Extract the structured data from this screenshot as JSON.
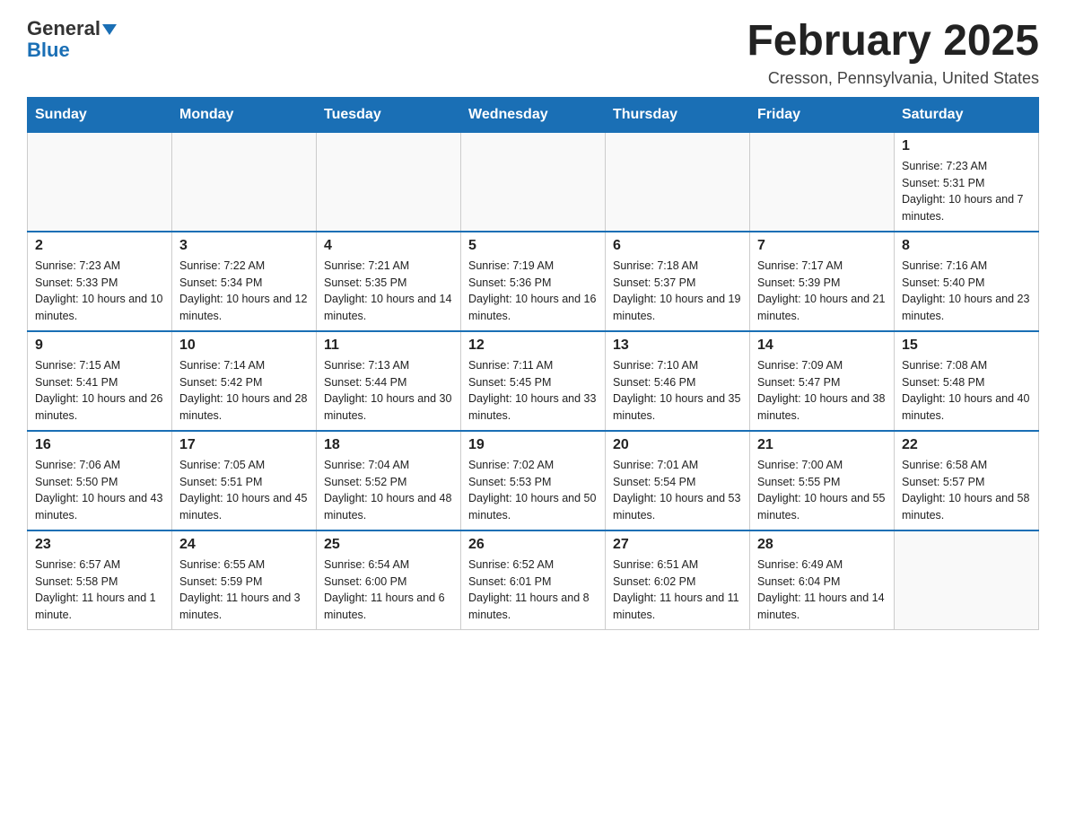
{
  "header": {
    "logo_general": "General",
    "logo_blue": "Blue",
    "month_title": "February 2025",
    "location": "Cresson, Pennsylvania, United States"
  },
  "days_of_week": [
    "Sunday",
    "Monday",
    "Tuesday",
    "Wednesday",
    "Thursday",
    "Friday",
    "Saturday"
  ],
  "weeks": [
    [
      {
        "day": "",
        "sunrise": "",
        "sunset": "",
        "daylight": ""
      },
      {
        "day": "",
        "sunrise": "",
        "sunset": "",
        "daylight": ""
      },
      {
        "day": "",
        "sunrise": "",
        "sunset": "",
        "daylight": ""
      },
      {
        "day": "",
        "sunrise": "",
        "sunset": "",
        "daylight": ""
      },
      {
        "day": "",
        "sunrise": "",
        "sunset": "",
        "daylight": ""
      },
      {
        "day": "",
        "sunrise": "",
        "sunset": "",
        "daylight": ""
      },
      {
        "day": "1",
        "sunrise": "Sunrise: 7:23 AM",
        "sunset": "Sunset: 5:31 PM",
        "daylight": "Daylight: 10 hours and 7 minutes."
      }
    ],
    [
      {
        "day": "2",
        "sunrise": "Sunrise: 7:23 AM",
        "sunset": "Sunset: 5:33 PM",
        "daylight": "Daylight: 10 hours and 10 minutes."
      },
      {
        "day": "3",
        "sunrise": "Sunrise: 7:22 AM",
        "sunset": "Sunset: 5:34 PM",
        "daylight": "Daylight: 10 hours and 12 minutes."
      },
      {
        "day": "4",
        "sunrise": "Sunrise: 7:21 AM",
        "sunset": "Sunset: 5:35 PM",
        "daylight": "Daylight: 10 hours and 14 minutes."
      },
      {
        "day": "5",
        "sunrise": "Sunrise: 7:19 AM",
        "sunset": "Sunset: 5:36 PM",
        "daylight": "Daylight: 10 hours and 16 minutes."
      },
      {
        "day": "6",
        "sunrise": "Sunrise: 7:18 AM",
        "sunset": "Sunset: 5:37 PM",
        "daylight": "Daylight: 10 hours and 19 minutes."
      },
      {
        "day": "7",
        "sunrise": "Sunrise: 7:17 AM",
        "sunset": "Sunset: 5:39 PM",
        "daylight": "Daylight: 10 hours and 21 minutes."
      },
      {
        "day": "8",
        "sunrise": "Sunrise: 7:16 AM",
        "sunset": "Sunset: 5:40 PM",
        "daylight": "Daylight: 10 hours and 23 minutes."
      }
    ],
    [
      {
        "day": "9",
        "sunrise": "Sunrise: 7:15 AM",
        "sunset": "Sunset: 5:41 PM",
        "daylight": "Daylight: 10 hours and 26 minutes."
      },
      {
        "day": "10",
        "sunrise": "Sunrise: 7:14 AM",
        "sunset": "Sunset: 5:42 PM",
        "daylight": "Daylight: 10 hours and 28 minutes."
      },
      {
        "day": "11",
        "sunrise": "Sunrise: 7:13 AM",
        "sunset": "Sunset: 5:44 PM",
        "daylight": "Daylight: 10 hours and 30 minutes."
      },
      {
        "day": "12",
        "sunrise": "Sunrise: 7:11 AM",
        "sunset": "Sunset: 5:45 PM",
        "daylight": "Daylight: 10 hours and 33 minutes."
      },
      {
        "day": "13",
        "sunrise": "Sunrise: 7:10 AM",
        "sunset": "Sunset: 5:46 PM",
        "daylight": "Daylight: 10 hours and 35 minutes."
      },
      {
        "day": "14",
        "sunrise": "Sunrise: 7:09 AM",
        "sunset": "Sunset: 5:47 PM",
        "daylight": "Daylight: 10 hours and 38 minutes."
      },
      {
        "day": "15",
        "sunrise": "Sunrise: 7:08 AM",
        "sunset": "Sunset: 5:48 PM",
        "daylight": "Daylight: 10 hours and 40 minutes."
      }
    ],
    [
      {
        "day": "16",
        "sunrise": "Sunrise: 7:06 AM",
        "sunset": "Sunset: 5:50 PM",
        "daylight": "Daylight: 10 hours and 43 minutes."
      },
      {
        "day": "17",
        "sunrise": "Sunrise: 7:05 AM",
        "sunset": "Sunset: 5:51 PM",
        "daylight": "Daylight: 10 hours and 45 minutes."
      },
      {
        "day": "18",
        "sunrise": "Sunrise: 7:04 AM",
        "sunset": "Sunset: 5:52 PM",
        "daylight": "Daylight: 10 hours and 48 minutes."
      },
      {
        "day": "19",
        "sunrise": "Sunrise: 7:02 AM",
        "sunset": "Sunset: 5:53 PM",
        "daylight": "Daylight: 10 hours and 50 minutes."
      },
      {
        "day": "20",
        "sunrise": "Sunrise: 7:01 AM",
        "sunset": "Sunset: 5:54 PM",
        "daylight": "Daylight: 10 hours and 53 minutes."
      },
      {
        "day": "21",
        "sunrise": "Sunrise: 7:00 AM",
        "sunset": "Sunset: 5:55 PM",
        "daylight": "Daylight: 10 hours and 55 minutes."
      },
      {
        "day": "22",
        "sunrise": "Sunrise: 6:58 AM",
        "sunset": "Sunset: 5:57 PM",
        "daylight": "Daylight: 10 hours and 58 minutes."
      }
    ],
    [
      {
        "day": "23",
        "sunrise": "Sunrise: 6:57 AM",
        "sunset": "Sunset: 5:58 PM",
        "daylight": "Daylight: 11 hours and 1 minute."
      },
      {
        "day": "24",
        "sunrise": "Sunrise: 6:55 AM",
        "sunset": "Sunset: 5:59 PM",
        "daylight": "Daylight: 11 hours and 3 minutes."
      },
      {
        "day": "25",
        "sunrise": "Sunrise: 6:54 AM",
        "sunset": "Sunset: 6:00 PM",
        "daylight": "Daylight: 11 hours and 6 minutes."
      },
      {
        "day": "26",
        "sunrise": "Sunrise: 6:52 AM",
        "sunset": "Sunset: 6:01 PM",
        "daylight": "Daylight: 11 hours and 8 minutes."
      },
      {
        "day": "27",
        "sunrise": "Sunrise: 6:51 AM",
        "sunset": "Sunset: 6:02 PM",
        "daylight": "Daylight: 11 hours and 11 minutes."
      },
      {
        "day": "28",
        "sunrise": "Sunrise: 6:49 AM",
        "sunset": "Sunset: 6:04 PM",
        "daylight": "Daylight: 11 hours and 14 minutes."
      },
      {
        "day": "",
        "sunrise": "",
        "sunset": "",
        "daylight": ""
      }
    ]
  ]
}
